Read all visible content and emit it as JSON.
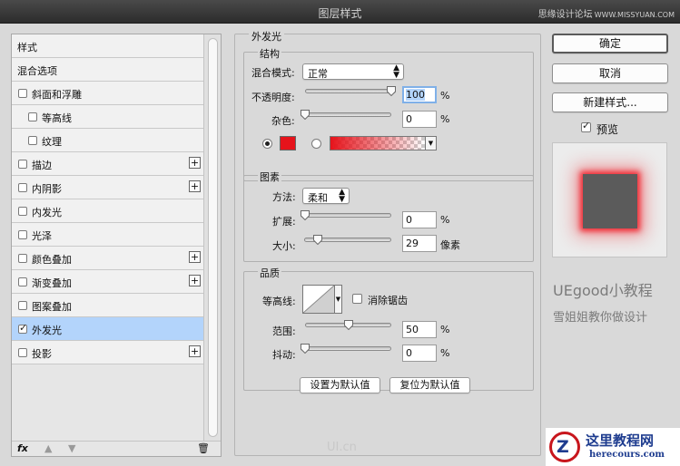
{
  "window": {
    "title": "图层样式",
    "watermark_main": "思缘设计论坛",
    "watermark_url": "WWW.MISSYUAN.COM"
  },
  "style_list": {
    "items": [
      {
        "label": "样式",
        "checkbox": false,
        "checked": false,
        "plus": false,
        "indent": false,
        "selected": false
      },
      {
        "label": "混合选项",
        "checkbox": false,
        "checked": false,
        "plus": false,
        "indent": false,
        "selected": false
      },
      {
        "label": "斜面和浮雕",
        "checkbox": true,
        "checked": false,
        "plus": false,
        "indent": false,
        "selected": false
      },
      {
        "label": "等高线",
        "checkbox": true,
        "checked": false,
        "plus": false,
        "indent": true,
        "selected": false
      },
      {
        "label": "纹理",
        "checkbox": true,
        "checked": false,
        "plus": false,
        "indent": true,
        "selected": false
      },
      {
        "label": "描边",
        "checkbox": true,
        "checked": false,
        "plus": true,
        "indent": false,
        "selected": false
      },
      {
        "label": "内阴影",
        "checkbox": true,
        "checked": false,
        "plus": true,
        "indent": false,
        "selected": false
      },
      {
        "label": "内发光",
        "checkbox": true,
        "checked": false,
        "plus": false,
        "indent": false,
        "selected": false
      },
      {
        "label": "光泽",
        "checkbox": true,
        "checked": false,
        "plus": false,
        "indent": false,
        "selected": false
      },
      {
        "label": "颜色叠加",
        "checkbox": true,
        "checked": false,
        "plus": true,
        "indent": false,
        "selected": false
      },
      {
        "label": "渐变叠加",
        "checkbox": true,
        "checked": false,
        "plus": true,
        "indent": false,
        "selected": false
      },
      {
        "label": "图案叠加",
        "checkbox": true,
        "checked": false,
        "plus": false,
        "indent": false,
        "selected": false
      },
      {
        "label": "外发光",
        "checkbox": true,
        "checked": true,
        "plus": false,
        "indent": false,
        "selected": true
      },
      {
        "label": "投影",
        "checkbox": true,
        "checked": false,
        "plus": true,
        "indent": false,
        "selected": false
      }
    ],
    "fx_label": "fx"
  },
  "outer_glow": {
    "title": "外发光",
    "structure": {
      "title": "结构",
      "blend_mode_label": "混合模式:",
      "blend_mode_value": "正常",
      "opacity_label": "不透明度:",
      "opacity_value": "100",
      "opacity_fraction": 1.0,
      "noise_label": "杂色:",
      "noise_value": "0",
      "noise_fraction": 0.0,
      "unit": "%",
      "color": "#e6131b",
      "color_radio_selected": true
    },
    "elements": {
      "title": "图素",
      "method_label": "方法:",
      "method_value": "柔和",
      "spread_label": "扩展:",
      "spread_value": "0",
      "spread_fraction": 0.0,
      "size_label": "大小:",
      "size_value": "29",
      "size_fraction": 0.12,
      "size_unit": "像素",
      "unit": "%"
    },
    "quality": {
      "title": "品质",
      "contour_label": "等高线:",
      "antialias_label": "消除锯齿",
      "antialias_checked": false,
      "range_label": "范围:",
      "range_value": "50",
      "range_fraction": 0.5,
      "jitter_label": "抖动:",
      "jitter_value": "0",
      "jitter_fraction": 0.0,
      "unit": "%"
    },
    "make_default_label": "设置为默认值",
    "reset_default_label": "复位为默认值"
  },
  "actions": {
    "ok_label": "确定",
    "cancel_label": "取消",
    "new_style_label": "新建样式...",
    "preview_label": "预览",
    "preview_checked": true
  },
  "branding": {
    "line1": "UEgood小教程",
    "line2": "雪姐姐教你做设计",
    "logo_title": "这里教程网",
    "logo_url": "herecours.com",
    "mid_mark": "UI.cn"
  }
}
